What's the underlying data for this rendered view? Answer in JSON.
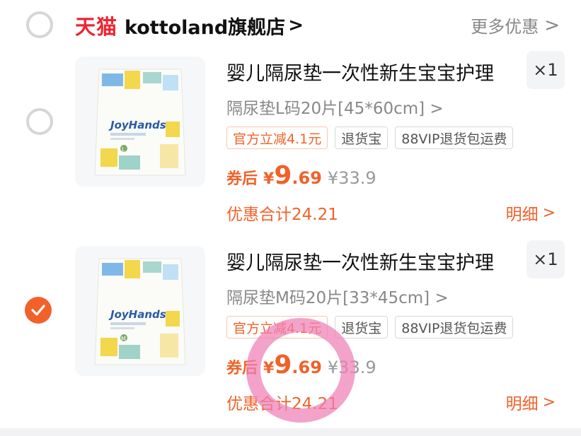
{
  "store": {
    "brand": "天猫",
    "name": "kottoland旗舰店",
    "chevron": ">",
    "more": "更多优惠"
  },
  "items": [
    {
      "title": "婴儿隔尿垫一次性新生宝宝护理",
      "quantity": "×1",
      "variant": "隔尿垫L码20片[45*60cm] >",
      "tags": [
        "官方立减4.1元",
        "退货宝",
        "88VIP退货包运费"
      ],
      "price_label": "券后",
      "price_currency": "¥",
      "price_integer": "9",
      "price_decimal": ".69",
      "original_price": "¥33.9",
      "discount_total": "优惠合计24.21",
      "detail_label": "明细",
      "selected": false,
      "product_brand": "JoyHands",
      "size_badge": "L"
    },
    {
      "title": "婴儿隔尿垫一次性新生宝宝护理",
      "quantity": "×1",
      "variant": "隔尿垫M码20片[33*45cm] >",
      "tags": [
        "官方立减4.1元",
        "退货宝",
        "88VIP退货包运费"
      ],
      "price_label": "券后",
      "price_currency": "¥",
      "price_integer": "9",
      "price_decimal": ".69",
      "original_price": "¥33.9",
      "discount_total": "优惠合计24.21",
      "detail_label": "明细",
      "selected": true,
      "product_brand": "JoyHands",
      "size_badge": "M"
    }
  ],
  "colors": {
    "accent": "#f0622a",
    "tmall_red": "#f0232f",
    "highlight_circle": "#ee7fb5"
  }
}
